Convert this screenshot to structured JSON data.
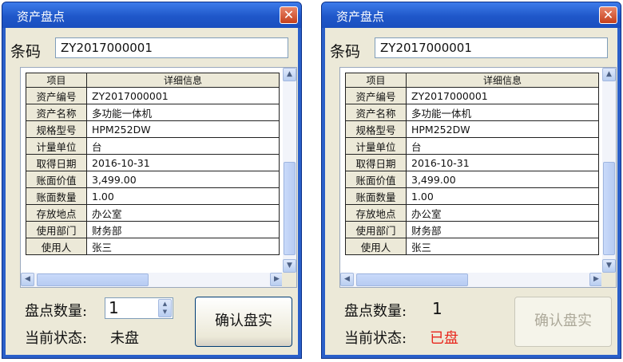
{
  "windows": [
    {
      "title": "资产盘点",
      "close_glyph": "✕",
      "barcode_label": "条码",
      "barcode_value": "ZY2017000001",
      "table": {
        "headers": [
          "项目",
          "详细信息"
        ],
        "rows": [
          [
            "资产编号",
            "ZY2017000001"
          ],
          [
            "资产名称",
            "多功能一体机"
          ],
          [
            "规格型号",
            "HPM252DW"
          ],
          [
            "计量单位",
            "台"
          ],
          [
            "取得日期",
            "2016-10-31"
          ],
          [
            "账面价值",
            "3,499.00"
          ],
          [
            "账面数量",
            "1.00"
          ],
          [
            "存放地点",
            "办公室"
          ],
          [
            "使用部门",
            "财务部"
          ],
          [
            "使用人",
            "张三"
          ]
        ]
      },
      "qty_label": "盘点数量:",
      "qty_value": "1",
      "status_label": "当前状态:",
      "status_value": "未盘",
      "status_color": "#111111",
      "confirm_label": "确认盘实",
      "confirm_enabled": true
    },
    {
      "title": "资产盘点",
      "close_glyph": "✕",
      "barcode_label": "条码",
      "barcode_value": "ZY2017000001",
      "table": {
        "headers": [
          "项目",
          "详细信息"
        ],
        "rows": [
          [
            "资产编号",
            "ZY2017000001"
          ],
          [
            "资产名称",
            "多功能一体机"
          ],
          [
            "规格型号",
            "HPM252DW"
          ],
          [
            "计量单位",
            "台"
          ],
          [
            "取得日期",
            "2016-10-31"
          ],
          [
            "账面价值",
            "3,499.00"
          ],
          [
            "账面数量",
            "1.00"
          ],
          [
            "存放地点",
            "办公室"
          ],
          [
            "使用部门",
            "财务部"
          ],
          [
            "使用人",
            "张三"
          ]
        ]
      },
      "qty_label": "盘点数量:",
      "qty_value": "1",
      "status_label": "当前状态:",
      "status_value": "已盘",
      "status_color": "#e8261c",
      "confirm_label": "确认盘实",
      "confirm_enabled": false
    }
  ]
}
